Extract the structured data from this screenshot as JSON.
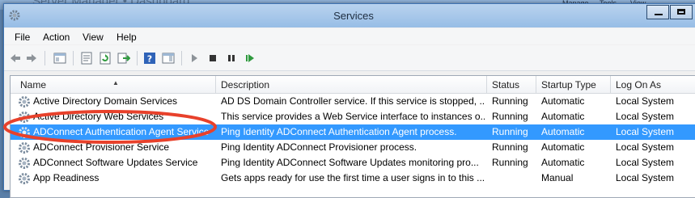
{
  "background_window": {
    "title": "Server Manager • Dashboard",
    "menu": [
      "Manage",
      "Tools",
      "View"
    ]
  },
  "window": {
    "title": "Services",
    "icon": "gear-services-icon"
  },
  "menubar": {
    "items": [
      "File",
      "Action",
      "View",
      "Help"
    ]
  },
  "toolbar": {
    "buttons": [
      "back-arrow-icon",
      "forward-arrow-icon",
      "show-hide-console-tree-icon",
      "properties-icon",
      "refresh-icon",
      "export-list-icon",
      "help-icon",
      "show-hide-action-pane-icon",
      "start-service-icon",
      "stop-service-icon",
      "pause-service-icon",
      "restart-service-icon"
    ]
  },
  "table": {
    "columns": [
      "Name",
      "Description",
      "Status",
      "Startup Type",
      "Log On As"
    ],
    "sorted_column": "Name",
    "rows": [
      {
        "name": "Active Directory Domain Services",
        "description": "AD DS Domain Controller service. If this service is stopped, ...",
        "status": "Running",
        "startup": "Automatic",
        "logon": "Local System",
        "selected": false
      },
      {
        "name": "Active Directory Web Services",
        "description": "This service provides a Web Service interface to instances o...",
        "status": "Running",
        "startup": "Automatic",
        "logon": "Local System",
        "selected": false
      },
      {
        "name": "ADConnect Authentication Agent Service",
        "description": "Ping Identity ADConnect Authentication Agent process.",
        "status": "Running",
        "startup": "Automatic",
        "logon": "Local System",
        "selected": true
      },
      {
        "name": "ADConnect Provisioner Service",
        "description": "Ping Identity ADConnect Provisioner process.",
        "status": "Running",
        "startup": "Automatic",
        "logon": "Local System",
        "selected": false
      },
      {
        "name": "ADConnect Software Updates Service",
        "description": "Ping Identity ADConnect Software Updates monitoring pro...",
        "status": "Running",
        "startup": "Automatic",
        "logon": "Local System",
        "selected": false
      },
      {
        "name": "App Readiness",
        "description": "Gets apps ready for use the first time a user signs in to this ...",
        "status": "",
        "startup": "Manual",
        "logon": "Local System",
        "selected": false
      }
    ]
  },
  "annotation": {
    "shape": "ellipse",
    "color": "#e8412b",
    "highlights": "ADConnect Authentication Agent Service"
  },
  "colors": {
    "selection": "#3399ff",
    "titlebar": "#a9c9ec"
  }
}
